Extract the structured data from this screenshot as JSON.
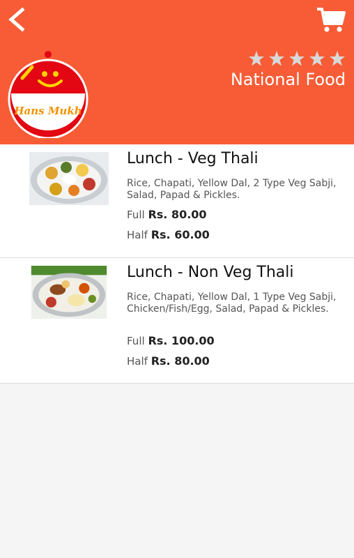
{
  "header": {
    "back_icon": "chevron-left-icon",
    "cart_icon": "cart-icon",
    "logo_text": "Hans Mukh",
    "restaurant_name": "National Food",
    "rating_stars": 5,
    "rating_value": 0,
    "colors": {
      "header_bg": "#f75c36",
      "star_color": "#d8d8d8"
    }
  },
  "menu": {
    "items": [
      {
        "title": "Lunch - Veg Thali",
        "description": "Rice, Chapati, Yellow Dal, 2 Type Veg Sabji, Salad, Papad & Pickles.",
        "prices": [
          {
            "size": "Full",
            "amount": "Rs. 80.00"
          },
          {
            "size": "Half",
            "amount": "Rs. 60.00"
          }
        ]
      },
      {
        "title": "Lunch - Non Veg Thali",
        "description": "Rice, Chapati, Yellow Dal, 1 Type Veg Sabji, Chicken/Fish/Egg, Salad, Papad & Pickles.",
        "prices": [
          {
            "size": "Full",
            "amount": "Rs. 100.00"
          },
          {
            "size": "Half",
            "amount": "Rs. 80.00"
          }
        ]
      }
    ]
  }
}
